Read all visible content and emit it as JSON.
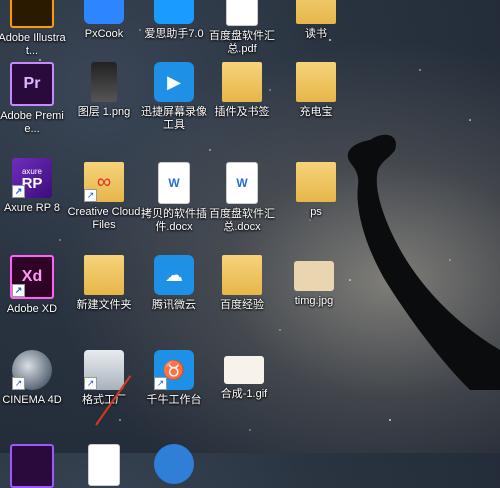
{
  "desktop": {
    "icons": [
      {
        "label": "Adobe Illustrat...",
        "icon": "illustrator-icon"
      },
      {
        "label": "PxCook",
        "icon": "pxcook-icon"
      },
      {
        "label": "爱思助手7.0",
        "icon": "aisi-icon"
      },
      {
        "label": "百度盘软件汇总.pdf",
        "icon": "pdf-icon"
      },
      {
        "label": "读书",
        "icon": "folder-icon"
      },
      {
        "label": "Adobe Premie...",
        "icon": "premiere-icon"
      },
      {
        "label": "图层 1.png",
        "icon": "image-icon"
      },
      {
        "label": "迅捷屏幕录像工具",
        "icon": "screen-recorder-icon"
      },
      {
        "label": "插件及书签",
        "icon": "folder-icon"
      },
      {
        "label": "充电宝",
        "icon": "folder-icon"
      },
      {
        "label": "Axure RP 8",
        "icon": "axure-icon"
      },
      {
        "label": "Creative Cloud Files",
        "icon": "creative-cloud-folder-icon"
      },
      {
        "label": "拷贝的软件插件.docx",
        "icon": "docx-icon"
      },
      {
        "label": "百度盘软件汇总.docx",
        "icon": "docx-icon"
      },
      {
        "label": "ps",
        "icon": "folder-icon"
      },
      {
        "label": "Adobe XD",
        "icon": "xd-icon"
      },
      {
        "label": "新建文件夹",
        "icon": "folder-icon"
      },
      {
        "label": "腾讯微云",
        "icon": "weiyun-icon"
      },
      {
        "label": "百度经验",
        "icon": "folder-icon"
      },
      {
        "label": "timg.jpg",
        "icon": "image-icon"
      },
      {
        "label": "CINEMA 4D",
        "icon": "cinema4d-icon"
      },
      {
        "label": "格式工厂",
        "icon": "format-factory-icon"
      },
      {
        "label": "千牛工作台",
        "icon": "qianniu-icon"
      },
      {
        "label": "合成-1.gif",
        "icon": "gif-icon"
      }
    ],
    "glyphs": {
      "pr": "Pr",
      "xd": "Xd",
      "axure_top": "axure",
      "axure": "RP",
      "shortcut": "↗"
    }
  }
}
